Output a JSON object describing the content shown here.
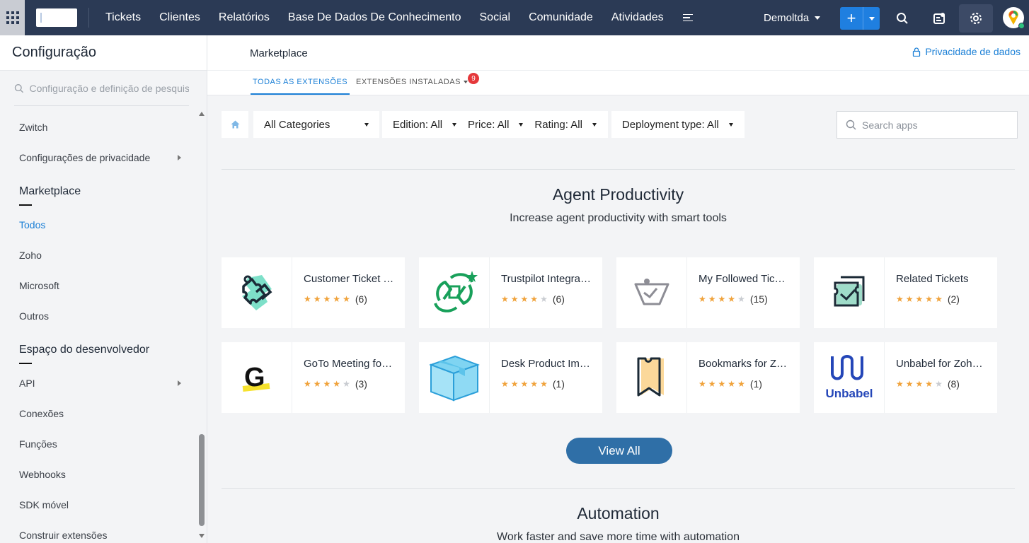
{
  "topbar": {
    "nav": [
      "Tickets",
      "Clientes",
      "Relatórios",
      "Base De Dados De Conhecimento",
      "Social",
      "Comunidade",
      "Atividades"
    ],
    "org": "Demoltda",
    "add_label": "+"
  },
  "sidebar": {
    "title": "Configuração",
    "search_placeholder": "Configuração e definição de pesquisa",
    "items_top": [
      {
        "label": "Zwitch",
        "arrow": false
      },
      {
        "label": "Configurações de privacidade",
        "arrow": true
      }
    ],
    "section_marketplace": "Marketplace",
    "marketplace_items": [
      {
        "label": "Todos",
        "active": true
      },
      {
        "label": "Zoho"
      },
      {
        "label": "Microsoft"
      },
      {
        "label": "Outros"
      }
    ],
    "section_dev": "Espaço do desenvolvedor",
    "dev_items": [
      {
        "label": "API",
        "arrow": true
      },
      {
        "label": "Conexões"
      },
      {
        "label": "Funções"
      },
      {
        "label": "Webhooks"
      },
      {
        "label": "SDK móvel"
      },
      {
        "label": "Construir extensões"
      }
    ]
  },
  "main": {
    "title": "Marketplace",
    "privacy_link": "Privacidade de dados",
    "tabs": [
      {
        "label": "TODAS AS EXTENSÕES",
        "active": true
      },
      {
        "label": "EXTENSÕES INSTALADAS",
        "badge": "9"
      }
    ],
    "filters": [
      "All Categories",
      "Edition: All",
      "Price: All",
      "Rating: All",
      "Deployment type: All"
    ],
    "search_placeholder": "Search apps",
    "section1": {
      "title": "Agent Productivity",
      "subtitle": "Increase agent productivity with smart tools"
    },
    "apps": [
      {
        "name": "Customer Ticket Timeline",
        "rating": 5,
        "count": "(6)",
        "icon": "ticket-icon"
      },
      {
        "name": "Trustpilot Integration",
        "rating": 4.5,
        "count": "(6)",
        "icon": "trustpilot-icon"
      },
      {
        "name": "My Followed Tickets",
        "rating": 4,
        "count": "(15)",
        "icon": "followed-icon"
      },
      {
        "name": "Related Tickets",
        "rating": 4.5,
        "count": "(2)",
        "icon": "related-icon"
      },
      {
        "name": "GoTo Meeting for Zoho Desk",
        "rating": 4,
        "count": "(3)",
        "icon": "goto-icon"
      },
      {
        "name": "Desk Product Importer",
        "rating": 5,
        "count": "(1)",
        "icon": "box-icon"
      },
      {
        "name": "Bookmarks for Zoho Desk",
        "rating": 5,
        "count": "(1)",
        "icon": "bookmark-icon"
      },
      {
        "name": "Unbabel for Zoho Desk",
        "rating": 3.5,
        "count": "(8)",
        "icon": "unbabel-icon"
      }
    ],
    "unbabel_text": "Unbabel",
    "view_all": "View All",
    "section2": {
      "title": "Automation",
      "subtitle": "Work faster and save more time with automation"
    }
  },
  "colors": {
    "topbar": "#2b3a55",
    "accent": "#1a7fd6",
    "star": "#f0a23a",
    "view_all": "#2f6fa7"
  }
}
